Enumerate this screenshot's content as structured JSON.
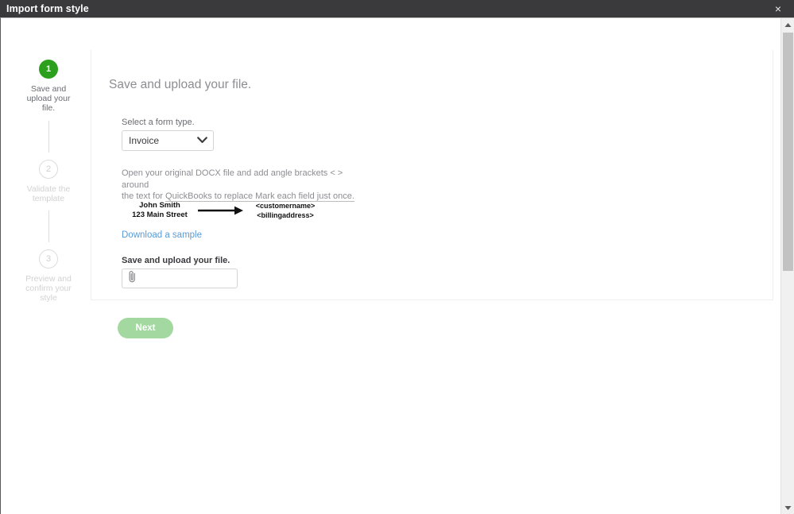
{
  "window": {
    "title": "Import form style",
    "close_label": "×",
    "close_icon": "close-icon"
  },
  "stepper": {
    "steps": [
      {
        "number": "1",
        "label": "Save and upload your file.",
        "state": "active"
      },
      {
        "number": "2",
        "label": "Validate the template",
        "state": "inactive"
      },
      {
        "number": "3",
        "label": "Preview and confirm your style",
        "state": "inactive"
      }
    ]
  },
  "main": {
    "title": "Save and upload your file.",
    "form_type": {
      "label": "Select a form type.",
      "value": "Invoice",
      "chevron_icon": "chevron-down-icon",
      "options": [
        "Invoice"
      ]
    },
    "instructions": {
      "line1": "Open your original DOCX file and add angle brackets < > around",
      "line2_prefix": "the text for ",
      "line2_hint": "QuickBooks to replace Mark each field just once."
    },
    "sample": {
      "left_line1": "John Smith",
      "left_line2": "123 Main Street",
      "arrow_icon": "arrow-right-icon",
      "right_line1": "<customername>",
      "right_line2": "<billingaddress>"
    },
    "download_link": "Download a sample",
    "upload": {
      "label": "Save and upload your file.",
      "value": "",
      "placeholder": "",
      "icon": "paperclip-icon"
    },
    "next_button": "Next"
  },
  "scrollbar": {
    "up_icon": "scroll-up-arrow-icon",
    "down_icon": "scroll-down-arrow-icon",
    "thumb": "scrollbar-thumb"
  },
  "colors": {
    "titlebar": "#3a3a3c",
    "accent_green": "#2ca01c",
    "disabled_green": "#a3d9a0",
    "link_blue": "#5a9ad6",
    "muted_text": "#8d8d93"
  }
}
